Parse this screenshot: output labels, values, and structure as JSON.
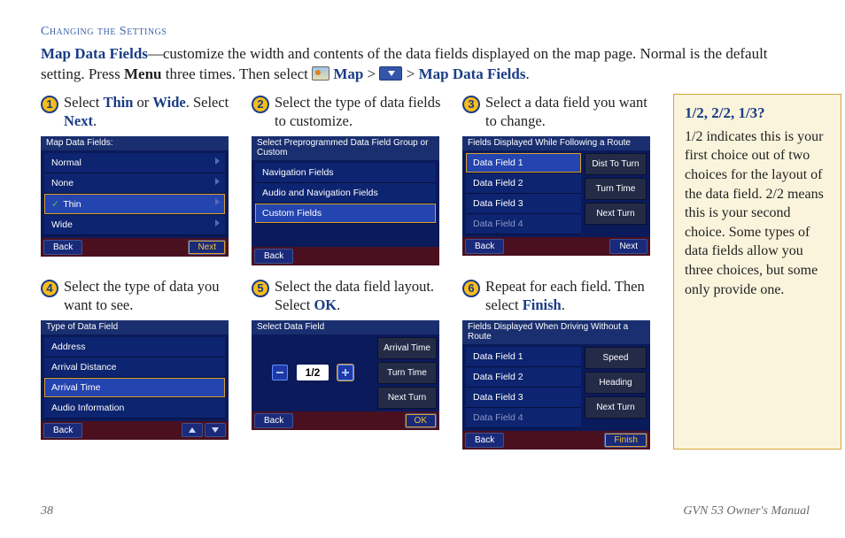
{
  "chapter": "Changing the Settings",
  "intro": {
    "title": "Map Data Fields",
    "dash": "—",
    "l1": "customize the width and contents of the data fields displayed on the map page. Normal is the default setting. Press ",
    "menu": "Menu",
    "l2": " three times. Then select ",
    "map": "Map",
    "gt": " > ",
    "mdf": "Map Data Fields",
    "dot": "."
  },
  "nums": {
    "1": "1",
    "2": "2",
    "3": "3",
    "4": "4",
    "5": "5",
    "6": "6"
  },
  "steps": {
    "s1a": "Select ",
    "s1b": "Thin",
    "s1c": " or ",
    "s1d": "Wide",
    "s1e": ". Select ",
    "s1f": "Next",
    "s1g": ".",
    "s2": "Select the type of data fields to customize.",
    "s3": "Select a data field you want to change.",
    "s4": "Select the type of data you want to see.",
    "s5a": "Select the data field layout. Select ",
    "s5b": "OK",
    "s5c": ".",
    "s6a": "Repeat for each field. Then select ",
    "s6b": "Finish",
    "s6c": "."
  },
  "dev": {
    "back": "Back",
    "next": "Next",
    "ok": "OK",
    "finish": "Finish",
    "d1": {
      "title": "Map Data Fields:",
      "r": [
        "Normal",
        "None",
        "Thin",
        "Wide"
      ]
    },
    "d2": {
      "title": "Select Preprogrammed Data Field Group or Custom",
      "r": [
        "Navigation Fields",
        "Audio and Navigation Fields",
        "Custom Fields"
      ]
    },
    "d3": {
      "title": "Fields Displayed While Following a Route",
      "left": [
        "Data Field 1",
        "Data Field 2",
        "Data Field 3",
        "Data Field 4"
      ],
      "right": [
        "Dist To Turn",
        "Turn Time",
        "Next Turn"
      ]
    },
    "d4": {
      "title": "Type of Data Field",
      "r": [
        "Address",
        "Arrival Distance",
        "Arrival Time",
        "Audio Information"
      ]
    },
    "d5": {
      "title": "Select Data Field",
      "right": [
        "Arrival Time",
        "Turn Time",
        "Next Turn"
      ],
      "counter": "1/2"
    },
    "d6": {
      "title": "Fields Displayed When Driving Without a Route",
      "left": [
        "Data Field 1",
        "Data Field 2",
        "Data Field 3",
        "Data Field 4"
      ],
      "right": [
        "Speed",
        "Heading",
        "Next Turn"
      ]
    }
  },
  "side": {
    "hd": "1/2, 2/2, 1/3?",
    "body": "1/2 indicates this is your first choice out of two choices for the layout of the data field. 2/2 means this is your second choice. Some types of data fields allow you three choices, but some only provide one."
  },
  "footer": {
    "page": "38",
    "manual": "GVN 53 Owner's Manual"
  }
}
